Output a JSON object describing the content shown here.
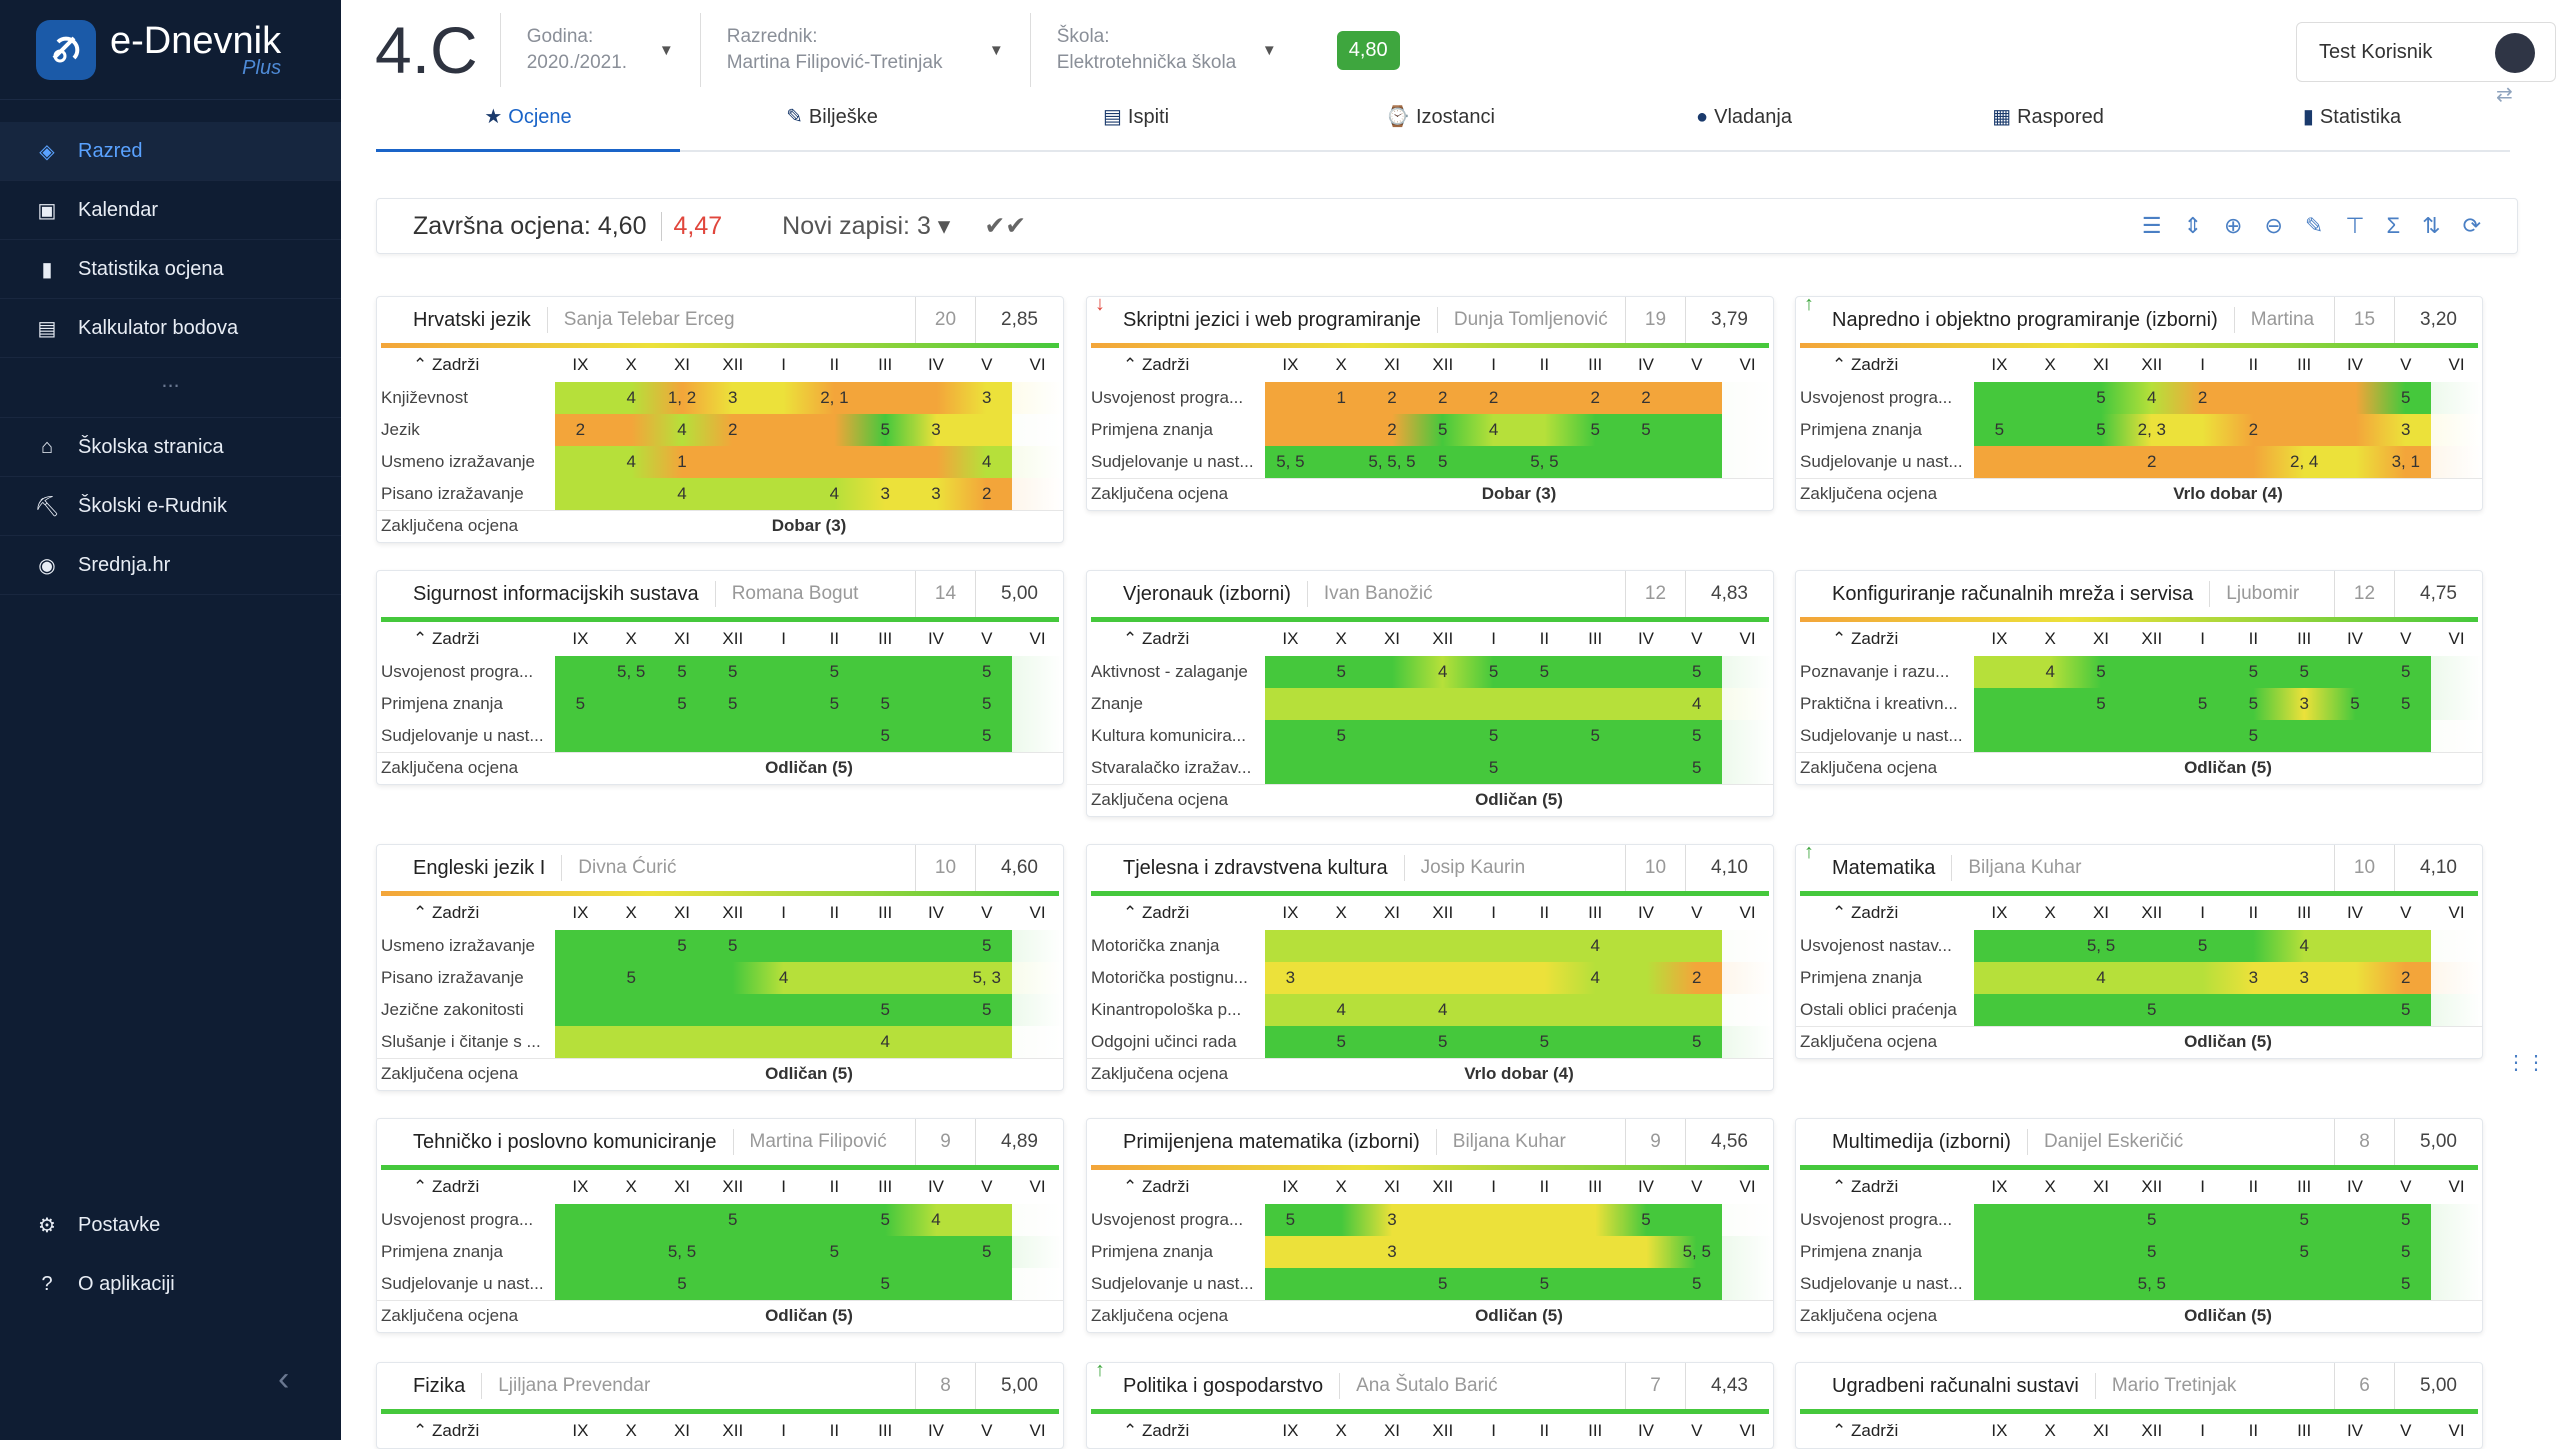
{
  "app": {
    "name": "e-Dnevnik",
    "plus": "Plus"
  },
  "sidebar": {
    "items": [
      {
        "label": "Razred",
        "icon": "class-icon",
        "active": true
      },
      {
        "label": "Kalendar",
        "icon": "calendar-icon"
      },
      {
        "label": "Statistika ocjena",
        "icon": "bar-chart-icon"
      },
      {
        "label": "Kalkulator bodova",
        "icon": "calculator-icon"
      }
    ],
    "dots": "...",
    "links": [
      {
        "label": "Školska stranica",
        "icon": "home-icon"
      },
      {
        "label": "Školski e-Rudnik",
        "icon": "mining-icon"
      },
      {
        "label": "Srednja.hr",
        "icon": "flame-icon"
      }
    ],
    "bottom": [
      {
        "label": "Postavke",
        "icon": "gear-icon"
      },
      {
        "label": "O aplikaciji",
        "icon": "help-icon"
      }
    ]
  },
  "header": {
    "class": "4.C",
    "year_label": "Godina:",
    "year": "2020./2021.",
    "teacher_label": "Razrednik:",
    "teacher": "Martina Filipović-Tretinjak",
    "school_label": "Škola:",
    "school": "Elektrotehnička škola",
    "average": "4,80",
    "user": "Test Korisnik"
  },
  "tabs": [
    {
      "label": "Ocjene",
      "icon": "★",
      "active": true
    },
    {
      "label": "Bilješke",
      "icon": "✎"
    },
    {
      "label": "Ispiti",
      "icon": "▤"
    },
    {
      "label": "Izostanci",
      "icon": "⌚"
    },
    {
      "label": "Vladanja",
      "icon": "●"
    },
    {
      "label": "Raspored",
      "icon": "▦"
    },
    {
      "label": "Statistika",
      "icon": "▮"
    }
  ],
  "summary": {
    "label": "Završna ocjena:",
    "value": "4,60",
    "alt": "4,47",
    "new_records": "Novi zapisi: 3 ▾",
    "check": "✔✔"
  },
  "tools": [
    "☰",
    "⇕",
    "⊕",
    "⊖",
    "✎",
    "⊤",
    "Σ",
    "⇅",
    "⟳"
  ],
  "months": [
    "IX",
    "X",
    "XI",
    "XII",
    "I",
    "II",
    "III",
    "IV",
    "V",
    "VI"
  ],
  "zadrzi": "Zadrži",
  "final_label": "Zaključena ocjena",
  "colors": {
    "green": "#45c83c",
    "yellowgreen": "#b6e03a",
    "yellow": "#ece13a",
    "orange": "#f3a53a",
    "red": "#e0463c",
    "accent": "#1a64c8"
  },
  "cards": [
    {
      "subject": "Hrvatski jezik",
      "teacher": "Sanja Telebar Erceg",
      "count": "20",
      "avg": "2,85",
      "bar": "multi",
      "final": "Dobar (3)",
      "rows": [
        {
          "label": "Književnost",
          "cells": [
            "",
            "4",
            "1, 2",
            "3",
            "",
            "2, 1",
            "",
            "",
            "3",
            ""
          ]
        },
        {
          "label": "Jezik",
          "cells": [
            "2",
            "",
            "4",
            "2",
            "",
            "",
            "5",
            "3",
            "",
            ""
          ]
        },
        {
          "label": "Usmeno izražavanje",
          "cells": [
            "",
            "4",
            "1",
            "",
            "",
            "",
            "",
            "",
            "4",
            ""
          ]
        },
        {
          "label": "Pisano izražavanje",
          "cells": [
            "",
            "",
            "4",
            "",
            "",
            "4",
            "3",
            "3",
            "2",
            ""
          ]
        }
      ]
    },
    {
      "subject": "Skriptni jezici i web programiranje",
      "teacher": "Dunja Tomljenović",
      "count": "19",
      "avg": "3,79",
      "bar": "multi",
      "arrow": "↓",
      "arrow_color": "#e0463c",
      "final": "Dobar (3)",
      "rows": [
        {
          "label": "Usvojenost progra...",
          "cells": [
            "",
            "1",
            "2",
            "2",
            "2",
            "",
            "2",
            "2",
            "",
            ""
          ]
        },
        {
          "label": "Primjena znanja",
          "cells": [
            "",
            "",
            "2",
            "5",
            "4",
            "",
            "5",
            "5",
            "",
            ""
          ]
        },
        {
          "label": "Sudjelovanje u nast...",
          "cells": [
            "5, 5",
            "",
            "5, 5, 5",
            "5",
            "",
            "5, 5",
            "",
            "",
            "",
            ""
          ]
        }
      ]
    },
    {
      "subject": "Napredno i objektno programiranje (izborni)",
      "teacher": "Martina",
      "count": "15",
      "avg": "3,20",
      "bar": "multi",
      "arrow": "↑",
      "arrow_color": "#3ea63e",
      "final": "Vrlo dobar (4)",
      "rows": [
        {
          "label": "Usvojenost progra...",
          "cells": [
            "",
            "",
            "5",
            "4",
            "2",
            "",
            "",
            "",
            "5",
            ""
          ]
        },
        {
          "label": "Primjena znanja",
          "cells": [
            "5",
            "",
            "5",
            "2, 3",
            "",
            "2",
            "",
            "",
            "3",
            ""
          ]
        },
        {
          "label": "Sudjelovanje u nast...",
          "cells": [
            "",
            "",
            "",
            "2",
            "",
            "",
            "2, 4",
            "",
            "3, 1",
            ""
          ]
        }
      ]
    },
    {
      "subject": "Sigurnost informacijskih sustava",
      "teacher": "Romana Bogut",
      "count": "14",
      "avg": "5,00",
      "bar": "green",
      "final": "Odličan (5)",
      "rows": [
        {
          "label": "Usvojenost progra...",
          "cells": [
            "",
            "5, 5",
            "5",
            "5",
            "",
            "5",
            "",
            "",
            "5",
            ""
          ]
        },
        {
          "label": "Primjena znanja",
          "cells": [
            "5",
            "",
            "5",
            "5",
            "",
            "5",
            "5",
            "",
            "5",
            ""
          ]
        },
        {
          "label": "Sudjelovanje u nast...",
          "cells": [
            "",
            "",
            "",
            "",
            "",
            "",
            "5",
            "",
            "5",
            ""
          ]
        }
      ]
    },
    {
      "subject": "Vjeronauk (izborni)",
      "teacher": "Ivan Banožić",
      "count": "12",
      "avg": "4,83",
      "bar": "green",
      "final": "Odličan (5)",
      "rows": [
        {
          "label": "Aktivnost - zalaganje",
          "cells": [
            "",
            "5",
            "",
            "4",
            "5",
            "5",
            "",
            "",
            "5",
            ""
          ]
        },
        {
          "label": "Znanje",
          "cells": [
            "",
            "",
            "",
            "",
            "",
            "",
            "",
            "",
            "4",
            ""
          ]
        },
        {
          "label": "Kultura komunicira...",
          "cells": [
            "",
            "5",
            "",
            "",
            "5",
            "",
            "5",
            "",
            "5",
            ""
          ]
        },
        {
          "label": "Stvaralačko izražav...",
          "cells": [
            "",
            "",
            "",
            "",
            "5",
            "",
            "",
            "",
            "5",
            ""
          ]
        }
      ]
    },
    {
      "subject": "Konfiguriranje računalnih mreža i servisa",
      "teacher": "Ljubomir",
      "count": "12",
      "avg": "4,75",
      "bar": "multi",
      "final": "Odličan (5)",
      "rows": [
        {
          "label": "Poznavanje i razu...",
          "cells": [
            "",
            "4",
            "5",
            "",
            "",
            "5",
            "5",
            "",
            "5",
            ""
          ]
        },
        {
          "label": "Praktična i kreativn...",
          "cells": [
            "",
            "",
            "5",
            "",
            "5",
            "5",
            "3",
            "5",
            "5",
            ""
          ]
        },
        {
          "label": "Sudjelovanje u nast...",
          "cells": [
            "",
            "",
            "",
            "",
            "",
            "5",
            "",
            "",
            "",
            ""
          ]
        }
      ]
    },
    {
      "subject": "Engleski jezik I",
      "teacher": "Divna Ćurić",
      "count": "10",
      "avg": "4,60",
      "bar": "multi",
      "final": "Odličan (5)",
      "rows": [
        {
          "label": "Usmeno izražavanje",
          "cells": [
            "",
            "",
            "5",
            "5",
            "",
            "",
            "",
            "",
            "5",
            ""
          ]
        },
        {
          "label": "Pisano izražavanje",
          "cells": [
            "",
            "5",
            "",
            "",
            "4",
            "",
            "",
            "",
            "5, 3",
            ""
          ]
        },
        {
          "label": "Jezične zakonitosti",
          "cells": [
            "",
            "",
            "",
            "",
            "",
            "",
            "5",
            "",
            "5",
            ""
          ]
        },
        {
          "label": "Slušanje i čitanje s ...",
          "cells": [
            "",
            "",
            "",
            "",
            "",
            "",
            "4",
            "",
            "",
            ""
          ]
        }
      ]
    },
    {
      "subject": "Tjelesna i zdravstvena kultura",
      "teacher": "Josip Kaurin",
      "count": "10",
      "avg": "4,10",
      "bar": "green",
      "final": "Vrlo dobar (4)",
      "rows": [
        {
          "label": "Motorička znanja",
          "cells": [
            "",
            "",
            "",
            "",
            "",
            "",
            "4",
            "",
            "",
            ""
          ]
        },
        {
          "label": "Motorička postignu...",
          "cells": [
            "3",
            "",
            "",
            "",
            "",
            "",
            "4",
            "",
            "2",
            ""
          ]
        },
        {
          "label": "Kinantropološka p...",
          "cells": [
            "",
            "4",
            "",
            "4",
            "",
            "",
            "",
            "",
            "",
            ""
          ]
        },
        {
          "label": "Odgojni učinci rada",
          "cells": [
            "",
            "5",
            "",
            "5",
            "",
            "5",
            "",
            "",
            "5",
            ""
          ]
        }
      ]
    },
    {
      "subject": "Matematika",
      "teacher": "Biljana Kuhar",
      "count": "10",
      "avg": "4,10",
      "bar": "green",
      "arrow": "↑",
      "arrow_color": "#3ea63e",
      "final": "Odličan (5)",
      "rows": [
        {
          "label": "Usvojenost nastav...",
          "cells": [
            "",
            "",
            "5, 5",
            "",
            "5",
            "",
            "4",
            "",
            "",
            ""
          ]
        },
        {
          "label": "Primjena znanja",
          "cells": [
            "",
            "",
            "4",
            "",
            "",
            "3",
            "3",
            "",
            "2",
            ""
          ]
        },
        {
          "label": "Ostali oblici praćenja",
          "cells": [
            "",
            "",
            "",
            "5",
            "",
            "",
            "",
            "",
            "5",
            ""
          ]
        }
      ]
    },
    {
      "subject": "Tehničko i poslovno komuniciranje",
      "teacher": "Martina Filipović",
      "count": "9",
      "avg": "4,89",
      "bar": "green",
      "final": "Odličan (5)",
      "rows": [
        {
          "label": "Usvojenost progra...",
          "cells": [
            "",
            "",
            "",
            "5",
            "",
            "",
            "5",
            "4",
            "",
            ""
          ]
        },
        {
          "label": "Primjena znanja",
          "cells": [
            "",
            "",
            "5, 5",
            "",
            "",
            "5",
            "",
            "",
            "5",
            ""
          ]
        },
        {
          "label": "Sudjelovanje u nast...",
          "cells": [
            "",
            "",
            "5",
            "",
            "",
            "",
            "5",
            "",
            "",
            ""
          ]
        }
      ]
    },
    {
      "subject": "Primijenjena matematika (izborni)",
      "teacher": "Biljana Kuhar",
      "count": "9",
      "avg": "4,56",
      "bar": "multi",
      "final": "Odličan (5)",
      "rows": [
        {
          "label": "Usvojenost progra...",
          "cells": [
            "5",
            "",
            "3",
            "",
            "",
            "",
            "",
            "5",
            "",
            ""
          ]
        },
        {
          "label": "Primjena znanja",
          "cells": [
            "",
            "",
            "3",
            "",
            "",
            "",
            "",
            "",
            "5, 5",
            ""
          ]
        },
        {
          "label": "Sudjelovanje u nast...",
          "cells": [
            "",
            "",
            "",
            "5",
            "",
            "5",
            "",
            "",
            "5",
            ""
          ]
        }
      ]
    },
    {
      "subject": "Multimedija (izborni)",
      "teacher": "Danijel Eskeričić",
      "count": "8",
      "avg": "5,00",
      "bar": "green",
      "final": "Odličan (5)",
      "rows": [
        {
          "label": "Usvojenost progra...",
          "cells": [
            "",
            "",
            "",
            "5",
            "",
            "",
            "5",
            "",
            "5",
            ""
          ]
        },
        {
          "label": "Primjena znanja",
          "cells": [
            "",
            "",
            "",
            "5",
            "",
            "",
            "5",
            "",
            "5",
            ""
          ]
        },
        {
          "label": "Sudjelovanje u nast...",
          "cells": [
            "",
            "",
            "",
            "5, 5",
            "",
            "",
            "",
            "",
            "5",
            ""
          ]
        }
      ]
    },
    {
      "subject": "Fizika",
      "teacher": "Ljiljana Prevendar",
      "count": "8",
      "avg": "5,00",
      "bar": "green",
      "rows": []
    },
    {
      "subject": "Politika i gospodarstvo",
      "teacher": "Ana Šutalo Barić",
      "count": "7",
      "avg": "4,43",
      "bar": "green",
      "arrow": "↑",
      "arrow_color": "#3ea63e",
      "rows": []
    },
    {
      "subject": "Ugradbeni računalni sustavi",
      "teacher": "Mario Tretinjak",
      "count": "6",
      "avg": "5,00",
      "bar": "green",
      "rows": []
    }
  ]
}
